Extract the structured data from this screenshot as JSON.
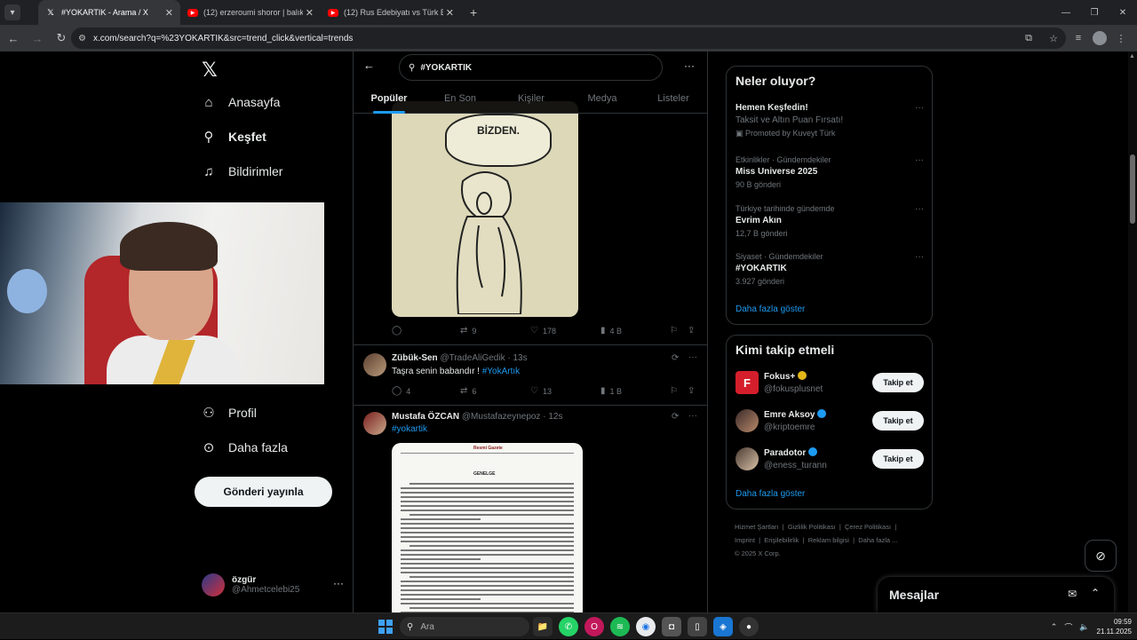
{
  "browser": {
    "tabs": [
      {
        "title": "#YOKARTIK - Arama / X",
        "favicon": "x-icon",
        "active": true
      },
      {
        "title": "(12) erzeroumi shoror | balıkesir",
        "favicon": "youtube-icon",
        "active": false
      },
      {
        "title": "(12) Rus Edebiyatı vs Türk Edeb",
        "favicon": "youtube-icon",
        "active": false
      }
    ],
    "url": "x.com/search?q=%23YOKARTIK&src=trend_click&vertical=trends"
  },
  "nav": {
    "items": [
      {
        "label": "Anasayfa",
        "icon": "home-icon"
      },
      {
        "label": "Keşfet",
        "icon": "search-icon"
      },
      {
        "label": "Bildirimler",
        "icon": "bell-icon"
      },
      {
        "label": "Profil",
        "icon": "person-icon"
      },
      {
        "label": "Daha fazla",
        "icon": "more-circle-icon"
      }
    ],
    "post_button": "Gönderi yayınla",
    "account": {
      "name": "özgür",
      "handle": "@Ahmetcelebi25"
    }
  },
  "search": {
    "query": "#YOKARTIK",
    "tabs": [
      "Popüler",
      "En Son",
      "Kişiler",
      "Medya",
      "Listeler"
    ],
    "active_tab": "Popüler"
  },
  "feed": {
    "first_post": {
      "image_text": "BİZDEN.",
      "stats": {
        "replies": "",
        "reposts": "9",
        "likes": "178",
        "views": "4 B"
      }
    },
    "posts": [
      {
        "name": "Zübük-Sen",
        "handle": "@TradeAliGedik",
        "time": "· 13s",
        "text": "Taşra senin babandır ! ",
        "hashtag": "#YokArtık",
        "stats": {
          "replies": "4",
          "reposts": "6",
          "likes": "13",
          "views": "1 B"
        }
      },
      {
        "name": "Mustafa ÖZCAN",
        "handle": "@Mustafazeynepoz",
        "time": "· 12s",
        "text": "",
        "hashtag": "#yokartik",
        "doc_header": "Resmi Gazete",
        "doc_sub": "GENELGE"
      }
    ]
  },
  "sidebar": {
    "trends_title": "Neler oluyor?",
    "trends": [
      {
        "context": "",
        "title": "Hemen Keşfedin!",
        "subtitle": "Taksit ve Altın Puan Fırsatı!",
        "promo": "Promoted by Kuveyt Türk",
        "count": ""
      },
      {
        "context": "Etkinlikler · Gündemdekiler",
        "title": "Miss Universe 2025",
        "subtitle": "",
        "promo": "",
        "count": "90 B gönderi"
      },
      {
        "context": "Türkiye tarihinde gündemde",
        "title": "Evrim Akın",
        "subtitle": "",
        "promo": "",
        "count": "12,7 B gönderi"
      },
      {
        "context": "Siyaset · Gündemdekiler",
        "title": "#YOKARTIK",
        "subtitle": "",
        "promo": "",
        "count": "3.927 gönderi"
      }
    ],
    "trends_more": "Daha fazla göster",
    "follow_title": "Kimi takip etmeli",
    "follow": [
      {
        "name": "Fokus+",
        "handle": "@fokusplusnet",
        "badge": "gold",
        "button": "Takip et"
      },
      {
        "name": "Emre Aksoy",
        "handle": "@kriptoemre",
        "badge": "blue",
        "button": "Takip et"
      },
      {
        "name": "Paradotor",
        "handle": "@eness_turann",
        "badge": "blue",
        "button": "Takip et"
      }
    ],
    "follow_more": "Daha fazla göster",
    "footer": [
      "Hizmet Şartları",
      "Gizlilik Politikası",
      "Çerez Politikası",
      "Imprint",
      "Erişilebilirlik",
      "Reklam bilgisi",
      "Daha fazla ...",
      "© 2025 X Corp."
    ]
  },
  "messages": {
    "title": "Mesajlar"
  },
  "taskbar": {
    "search_placeholder": "Ara",
    "time": "09:59",
    "date": "21.11.2025"
  },
  "colors": {
    "accent": "#1d9bf0",
    "bg": "#000000",
    "border": "#2f3336",
    "muted": "#71767b"
  }
}
